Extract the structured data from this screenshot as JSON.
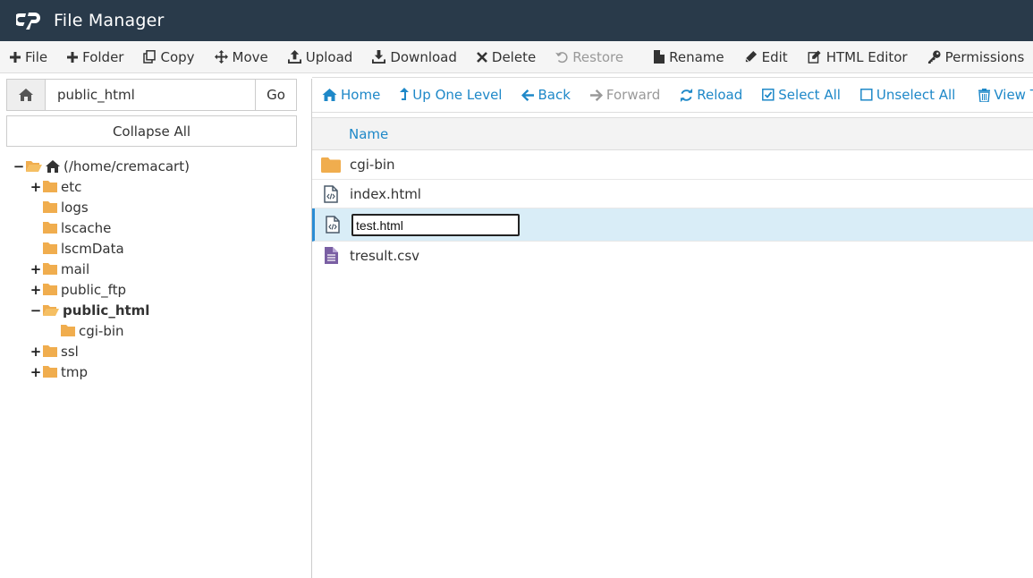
{
  "header": {
    "title": "File Manager"
  },
  "toolbar": {
    "file": "File",
    "folder": "Folder",
    "copy": "Copy",
    "move": "Move",
    "upload": "Upload",
    "download": "Download",
    "delete": "Delete",
    "restore": "Restore",
    "rename": "Rename",
    "edit": "Edit",
    "html_editor": "HTML Editor",
    "permissions": "Permissions"
  },
  "path": {
    "value": "public_html",
    "go": "Go"
  },
  "collapse_all": "Collapse All",
  "tree": {
    "root": "(/home/cremacart)",
    "etc": "etc",
    "logs": "logs",
    "lscache": "lscache",
    "lscmData": "lscmData",
    "mail": "mail",
    "public_ftp": "public_ftp",
    "public_html": "public_html",
    "cgi_bin": "cgi-bin",
    "ssl": "ssl",
    "tmp": "tmp"
  },
  "nav": {
    "home": "Home",
    "up_one_level": "Up One Level",
    "back": "Back",
    "forward": "Forward",
    "reload": "Reload",
    "select_all": "Select All",
    "unselect_all": "Unselect All",
    "view_trash": "View Trash"
  },
  "table": {
    "name_header": "Name"
  },
  "files": [
    {
      "name": "cgi-bin",
      "type": "folder"
    },
    {
      "name": "index.html",
      "type": "html"
    },
    {
      "name": "test.html",
      "type": "html",
      "renaming": true
    },
    {
      "name": "tresult.csv",
      "type": "text"
    }
  ],
  "colors": {
    "header_bg": "#293a4a",
    "link": "#1e88c8",
    "folder": "#f0ad4e",
    "selected_row": "#d9edf7"
  }
}
